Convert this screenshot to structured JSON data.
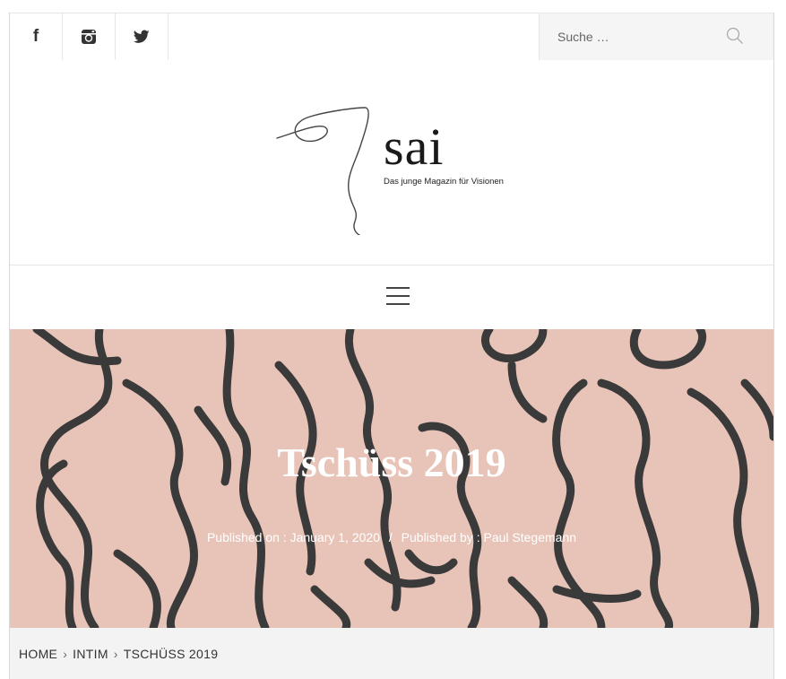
{
  "social": {
    "facebook_glyph": "f",
    "icons": [
      "facebook-icon",
      "instagram-icon",
      "twitter-icon"
    ]
  },
  "search": {
    "placeholder": "Suche …"
  },
  "branding": {
    "name": "sai",
    "tagline": "Das junge Magazin für Visionen"
  },
  "hero": {
    "title": "Tschüss 2019",
    "published_on_label": "Published on :",
    "published_on_value": "January 1, 2020",
    "separator": "/",
    "published_by_label": "Published by :",
    "published_by_value": "Paul Stegemann"
  },
  "breadcrumb": {
    "items": [
      "HOME",
      "INTIM",
      "TSCHÜSS 2019"
    ],
    "arrow": "›"
  },
  "colors": {
    "hero_background": "#e8c4b8",
    "line_art": "#3a3a3a",
    "breadcrumb_background": "#f3f3f3"
  }
}
